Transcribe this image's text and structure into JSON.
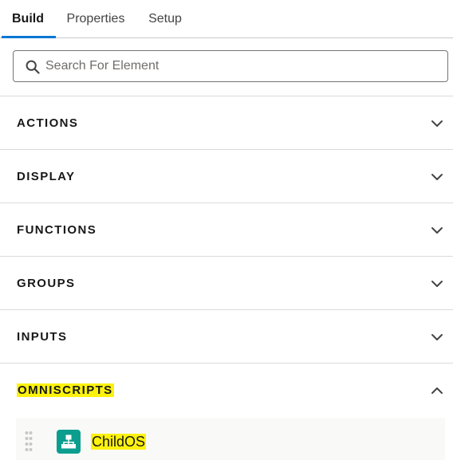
{
  "tabs": [
    {
      "label": "Build",
      "active": true
    },
    {
      "label": "Properties",
      "active": false
    },
    {
      "label": "Setup",
      "active": false
    }
  ],
  "search": {
    "placeholder": "Search For Element",
    "value": "",
    "icon": "search-icon"
  },
  "sections": [
    {
      "label": "ACTIONS",
      "expanded": false,
      "icon": "chevron-down-icon"
    },
    {
      "label": "DISPLAY",
      "expanded": false,
      "icon": "chevron-down-icon"
    },
    {
      "label": "FUNCTIONS",
      "expanded": false,
      "icon": "chevron-down-icon"
    },
    {
      "label": "GROUPS",
      "expanded": false,
      "icon": "chevron-down-icon"
    },
    {
      "label": "INPUTS",
      "expanded": false,
      "icon": "chevron-down-icon"
    },
    {
      "label": "OMNISCRIPTS",
      "expanded": true,
      "highlighted": true,
      "icon": "chevron-up-icon"
    }
  ],
  "omniscripts": {
    "items": [
      {
        "label": "ChildOS",
        "icon": "hierarchy-icon",
        "highlighted": true
      }
    ]
  },
  "colors": {
    "accent": "#0176d3",
    "highlight": "#fdf20d",
    "item_icon_bg": "#0b9e8f"
  }
}
